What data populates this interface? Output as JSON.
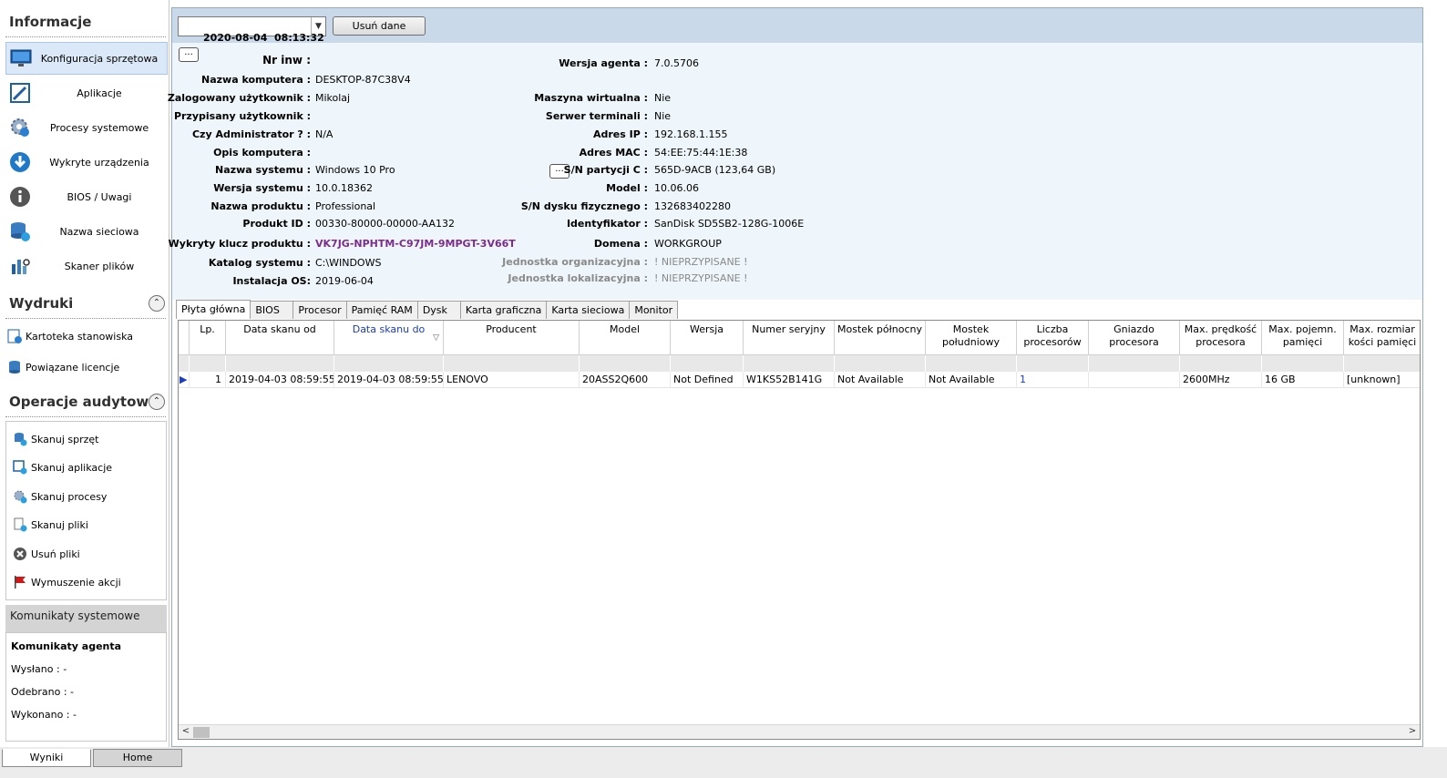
{
  "sidebar": {
    "info_header": "Informacje",
    "nav": [
      {
        "label": "Konfiguracja sprzętowa",
        "icon": "monitor-icon"
      },
      {
        "label": "Aplikacje",
        "icon": "application-icon"
      },
      {
        "label": "Procesy systemowe",
        "icon": "gear-process-icon"
      },
      {
        "label": "Wykryte urządzenia",
        "icon": "download-arrow-icon"
      },
      {
        "label": "BIOS / Uwagi",
        "icon": "info-icon"
      },
      {
        "label": "Nazwa sieciowa",
        "icon": "network-database-icon"
      },
      {
        "label": "Skaner plików",
        "icon": "file-scanner-icon"
      }
    ],
    "print_header": "Wydruki",
    "print_items": [
      {
        "label": "Kartoteka stanowiska",
        "icon": "document-check-icon"
      },
      {
        "label": "Powiązane licencje",
        "icon": "license-icon"
      }
    ],
    "audit_header": "Operacje audytowe",
    "audit_items": [
      {
        "label": "Skanuj sprzęt",
        "icon": "scan-hardware-icon"
      },
      {
        "label": "Skanuj aplikacje",
        "icon": "scan-apps-icon"
      },
      {
        "label": "Skanuj procesy",
        "icon": "scan-process-icon"
      },
      {
        "label": "Skanuj pliki",
        "icon": "scan-files-icon"
      },
      {
        "label": "Usuń pliki",
        "icon": "delete-icon"
      },
      {
        "label": "Wymuszenie akcji",
        "icon": "red-flag-icon"
      }
    ],
    "messages_header": "Komunikaty systemowe",
    "agent_messages_title": "Komunikaty agenta",
    "sent": "Wysłano :  -",
    "received": "Odebrano :  -",
    "done": "Wykonano : -"
  },
  "bottom_tabs": {
    "results": "Wyniki",
    "home": "Home"
  },
  "toolbar": {
    "datetime": "2020-08-04  08:13:32",
    "delete_button": "Usuń dane",
    "ellipsis": "..."
  },
  "info": {
    "left": [
      {
        "label": "Nr inw :",
        "value": ""
      },
      {
        "label": "Nazwa komputera :",
        "value": "DESKTOP-87C38V4"
      },
      {
        "label": "Zalogowany użytkownik :",
        "value": "Mikolaj"
      },
      {
        "label": "Przypisany użytkownik :",
        "value": ""
      },
      {
        "label": "Czy Administrator ? :",
        "value": "N/A"
      },
      {
        "label": "Opis komputera :",
        "value": ""
      },
      {
        "label": "Nazwa systemu :",
        "value": "Windows 10 Pro"
      },
      {
        "label": "Wersja systemu :",
        "value": "10.0.18362"
      },
      {
        "label": "Nazwa produktu :",
        "value": "Professional"
      },
      {
        "label": "Produkt ID :",
        "value": "00330-80000-00000-AA132"
      },
      {
        "label": "Wykryty klucz produktu :",
        "value": "VK7JG-NPHTM-C97JM-9MPGT-3V66T"
      },
      {
        "label": "Katalog systemu :",
        "value": "C:\\WINDOWS"
      },
      {
        "label": "Instalacja OS:",
        "value": "2019-06-04"
      }
    ],
    "right": [
      {
        "label": "Wersja agenta :",
        "value": "7.0.5706"
      },
      {
        "label": "Maszyna wirtualna :",
        "value": "Nie"
      },
      {
        "label": "Serwer terminali :",
        "value": "Nie"
      },
      {
        "label": "Adres IP :",
        "value": "192.168.1.155"
      },
      {
        "label": "Adres MAC :",
        "value": "54:EE:75:44:1E:38"
      },
      {
        "label": "S/N partycji C :",
        "value": "565D-9ACB (123,64 GB)"
      },
      {
        "label": "Model :",
        "value": "10.06.06"
      },
      {
        "label": "S/N dysku fizycznego :",
        "value": "132683402280"
      },
      {
        "label": "Identyfikator :",
        "value": "SanDisk SD5SB2-128G-1006E"
      },
      {
        "label": "Domena :",
        "value": "WORKGROUP"
      },
      {
        "label": "Jednostka organizacyjna :",
        "value": "! NIEPRZYPISANE !"
      },
      {
        "label": "Jednostka lokalizacyjna :",
        "value": "! NIEPRZYPISANE !"
      }
    ]
  },
  "tabs": [
    "Płyta główna",
    "BIOS",
    "Procesor",
    "Pamięć RAM",
    "Dysk",
    "Karta graficzna",
    "Karta sieciowa",
    "Monitor"
  ],
  "table": {
    "columns": [
      "",
      "Lp.",
      "Data skanu od",
      "Data skanu do",
      "Producent",
      "Model",
      "Wersja",
      "Numer seryjny",
      "Mostek północny",
      "Mostek\npołudniowy",
      "Liczba\nprocesorów",
      "Gniazdo\nprocesora",
      "Max. prędkość\nprocesora",
      "Max. pojemn.\npamięci",
      "Max. rozmiar\nkości pamięci"
    ],
    "row": [
      "",
      "1",
      "2019-04-03 08:59:55",
      "2019-04-03 08:59:55",
      "LENOVO",
      "20ASS2Q600",
      "Not Defined",
      "W1KS52B141G",
      "Not Available",
      "Not Available",
      "1",
      "",
      "2600MHz",
      "16 GB",
      "[unknown]"
    ]
  }
}
